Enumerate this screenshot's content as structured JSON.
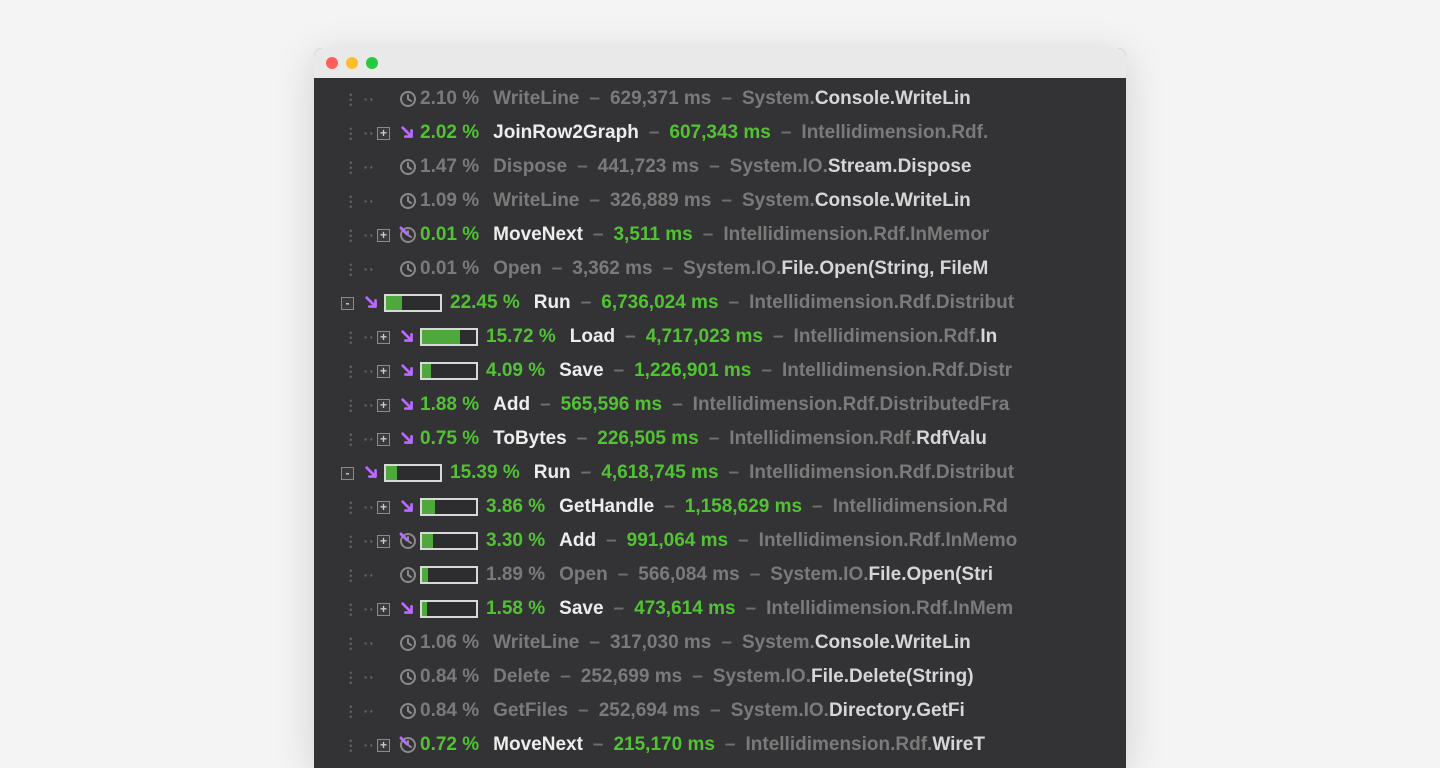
{
  "rows": [
    {
      "depth": 1,
      "expander": "",
      "icon": "clock",
      "bar": null,
      "active": false,
      "pct": "2.10 %",
      "method": "WriteLine",
      "ms": "629,371 ms",
      "nsPrefix": "System.",
      "nsBold": "Console.WriteLin"
    },
    {
      "depth": 1,
      "expander": "+",
      "icon": "arrow",
      "bar": null,
      "active": true,
      "pct": "2.02 %",
      "method": "JoinRow2Graph",
      "ms": "607,343 ms",
      "nsPrefix": "Intellidimension.Rdf.",
      "nsBold": ""
    },
    {
      "depth": 1,
      "expander": "",
      "icon": "clock",
      "bar": null,
      "active": false,
      "pct": "1.47 %",
      "method": "Dispose",
      "ms": "441,723 ms",
      "nsPrefix": "System.IO.",
      "nsBold": "Stream.Dispose"
    },
    {
      "depth": 1,
      "expander": "",
      "icon": "clock",
      "bar": null,
      "active": false,
      "pct": "1.09 %",
      "method": "WriteLine",
      "ms": "326,889 ms",
      "nsPrefix": "System.",
      "nsBold": "Console.WriteLin"
    },
    {
      "depth": 1,
      "expander": "+",
      "icon": "clockpurple",
      "bar": null,
      "active": true,
      "pct": "0.01 %",
      "method": "MoveNext",
      "ms": "3,511 ms",
      "nsPrefix": "Intellidimension.Rdf.InMemor",
      "nsBold": ""
    },
    {
      "depth": 1,
      "expander": "",
      "icon": "clock",
      "bar": null,
      "active": false,
      "pct": "0.01 %",
      "method": "Open",
      "ms": "3,362 ms",
      "nsPrefix": "System.IO.",
      "nsBold": "File.Open(String, FileM"
    },
    {
      "depth": 0,
      "expander": "-",
      "icon": "arrow",
      "bar": 30,
      "active": true,
      "pct": "22.45 %",
      "method": "Run",
      "ms": "6,736,024 ms",
      "nsPrefix": "Intellidimension.Rdf.Distribut",
      "nsBold": ""
    },
    {
      "depth": 1,
      "expander": "+",
      "icon": "arrow",
      "bar": 70,
      "active": true,
      "pct": "15.72 %",
      "method": "Load",
      "ms": "4,717,023 ms",
      "nsPrefix": "Intellidimension.Rdf.",
      "nsBold": "In"
    },
    {
      "depth": 1,
      "expander": "+",
      "icon": "arrow",
      "bar": 17,
      "active": true,
      "pct": "4.09 %",
      "method": "Save",
      "ms": "1,226,901 ms",
      "nsPrefix": "Intellidimension.Rdf.Distr",
      "nsBold": ""
    },
    {
      "depth": 1,
      "expander": "+",
      "icon": "arrow",
      "bar": null,
      "active": true,
      "pct": "1.88 %",
      "method": "Add",
      "ms": "565,596 ms",
      "nsPrefix": "Intellidimension.Rdf.DistributedFra",
      "nsBold": ""
    },
    {
      "depth": 1,
      "expander": "+",
      "icon": "arrow",
      "bar": null,
      "active": true,
      "pct": "0.75 %",
      "method": "ToBytes",
      "ms": "226,505 ms",
      "nsPrefix": "Intellidimension.Rdf.",
      "nsBold": "RdfValu"
    },
    {
      "depth": 0,
      "expander": "-",
      "icon": "arrow",
      "bar": 20,
      "active": true,
      "pct": "15.39 %",
      "method": "Run",
      "ms": "4,618,745 ms",
      "nsPrefix": "Intellidimension.Rdf.Distribut",
      "nsBold": ""
    },
    {
      "depth": 1,
      "expander": "+",
      "icon": "arrow",
      "bar": 24,
      "active": true,
      "pct": "3.86 %",
      "method": "GetHandle",
      "ms": "1,158,629 ms",
      "nsPrefix": "Intellidimension.Rd",
      "nsBold": ""
    },
    {
      "depth": 1,
      "expander": "+",
      "icon": "clockpurple",
      "bar": 20,
      "active": true,
      "pct": "3.30 %",
      "method": "Add",
      "ms": "991,064 ms",
      "nsPrefix": "Intellidimension.Rdf.InMemo",
      "nsBold": ""
    },
    {
      "depth": 1,
      "expander": "",
      "icon": "clock",
      "bar": 11,
      "active": false,
      "pct": "1.89 %",
      "method": "Open",
      "ms": "566,084 ms",
      "nsPrefix": "System.IO.",
      "nsBold": "File.Open(Stri"
    },
    {
      "depth": 1,
      "expander": "+",
      "icon": "arrow",
      "bar": 9,
      "active": true,
      "pct": "1.58 %",
      "method": "Save",
      "ms": "473,614 ms",
      "nsPrefix": "Intellidimension.Rdf.InMem",
      "nsBold": ""
    },
    {
      "depth": 1,
      "expander": "",
      "icon": "clock",
      "bar": null,
      "active": false,
      "pct": "1.06 %",
      "method": "WriteLine",
      "ms": "317,030 ms",
      "nsPrefix": "System.",
      "nsBold": "Console.WriteLin"
    },
    {
      "depth": 1,
      "expander": "",
      "icon": "clock",
      "bar": null,
      "active": false,
      "pct": "0.84 %",
      "method": "Delete",
      "ms": "252,699 ms",
      "nsPrefix": "System.IO.",
      "nsBold": "File.Delete(String)"
    },
    {
      "depth": 1,
      "expander": "",
      "icon": "clock",
      "bar": null,
      "active": false,
      "pct": "0.84 %",
      "method": "GetFiles",
      "ms": "252,694 ms",
      "nsPrefix": "System.IO.",
      "nsBold": "Directory.GetFi"
    },
    {
      "depth": 1,
      "expander": "+",
      "icon": "clockpurple",
      "bar": null,
      "active": true,
      "pct": "0.72 %",
      "method": "MoveNext",
      "ms": "215,170 ms",
      "nsPrefix": "Intellidimension.Rdf.",
      "nsBold": "WireT"
    }
  ]
}
